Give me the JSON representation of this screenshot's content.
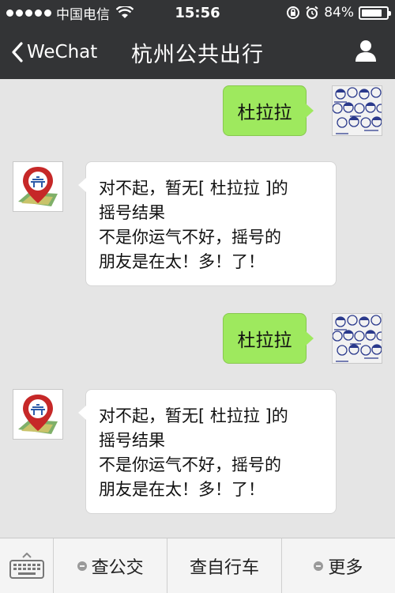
{
  "status_bar": {
    "carrier": "中国电信",
    "time": "15:56",
    "battery": "84%",
    "battery_level": 0.84
  },
  "nav": {
    "back_label": "WeChat",
    "title": "杭州公共出行"
  },
  "messages": [
    {
      "direction": "outgoing",
      "text": "杜拉拉"
    },
    {
      "direction": "incoming",
      "lines": [
        "对不起，暂无[ 杜拉拉 ]的",
        "摇号结果",
        "不是你运气不好，摇号的",
        "朋友是在太！多！了！"
      ]
    },
    {
      "direction": "outgoing",
      "text": "杜拉拉"
    },
    {
      "direction": "incoming",
      "lines": [
        "对不起，暂无[ 杜拉拉 ]的",
        "摇号结果",
        "不是你运气不好，摇号的",
        "朋友是在太！多！了！"
      ]
    }
  ],
  "toolbar": {
    "menu_1": "查公交",
    "menu_2": "查自行车",
    "menu_3": "更多"
  },
  "colors": {
    "nav_background": "#333436",
    "chat_background": "#e5e5e5",
    "outgoing_bubble": "#9ee95e",
    "incoming_bubble": "#ffffff"
  },
  "icons": {
    "back": "chevron-left-icon",
    "contact": "person-icon",
    "keyboard": "keyboard-icon",
    "bot_avatar": "map-pin-logo-icon"
  }
}
